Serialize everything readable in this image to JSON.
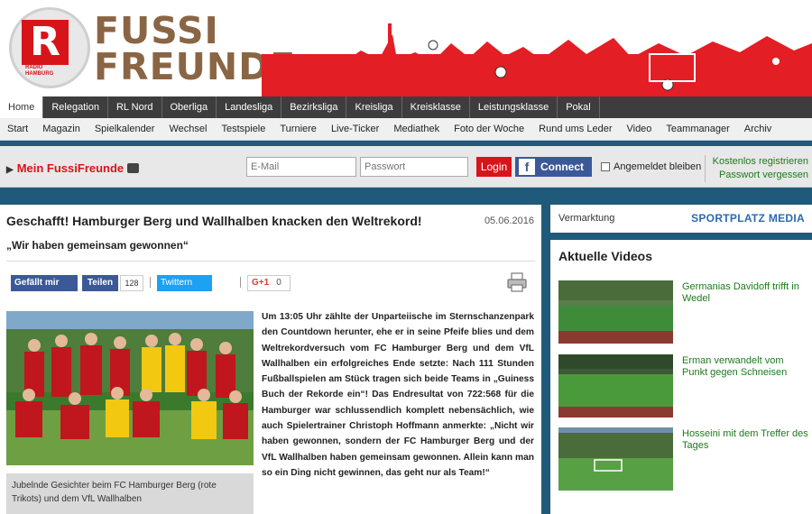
{
  "header": {
    "brand_line1": "FUSSI",
    "brand_line2": "FREUNDE",
    "logo_letter": "R",
    "logo_small": "RADIO HAMBURG",
    "accent": "#d8141b",
    "brand_color": "#8a6544"
  },
  "nav_primary": [
    {
      "label": "Home",
      "active": true
    },
    {
      "label": "Relegation"
    },
    {
      "label": "RL Nord"
    },
    {
      "label": "Oberliga"
    },
    {
      "label": "Landesliga"
    },
    {
      "label": "Bezirksliga"
    },
    {
      "label": "Kreisliga"
    },
    {
      "label": "Kreisklasse"
    },
    {
      "label": "Leistungsklasse"
    },
    {
      "label": "Pokal"
    }
  ],
  "nav_secondary": [
    {
      "label": "Start"
    },
    {
      "label": "Magazin"
    },
    {
      "label": "Spielkalender"
    },
    {
      "label": "Wechsel"
    },
    {
      "label": "Testspiele"
    },
    {
      "label": "Turniere"
    },
    {
      "label": "Live-Ticker"
    },
    {
      "label": "Mediathek"
    },
    {
      "label": "Foto der Woche"
    },
    {
      "label": "Rund ums Leder"
    },
    {
      "label": "Video"
    },
    {
      "label": "Teammanager"
    },
    {
      "label": "Archiv"
    }
  ],
  "login": {
    "mein_label": "Mein FussiFreunde",
    "email_placeholder": "E-Mail",
    "password_placeholder": "Passwort",
    "login_label": "Login",
    "connect_label": "Connect",
    "remember_label": "Angemeldet bleiben",
    "register_label": "Kostenlos registrieren",
    "forgot_label": "Passwort vergessen"
  },
  "article": {
    "headline": "Geschafft! Hamburger Berg und Wallhalben knacken den Weltrekord!",
    "date": "05.06.2016",
    "subheadline": "„Wir haben gemeinsam gewonnen“",
    "share": {
      "fb_like": "Gefällt mir",
      "fb_share": "Teilen",
      "fb_count": "128",
      "twitter": "Twittern",
      "gplus": "G+1",
      "gplus_count": "0"
    },
    "caption": "Jubelnde Gesichter beim FC Hamburger Berg (rote Trikots) und dem VfL Wallhalben",
    "body": "Um 13:05 Uhr zählte der Unparteiische im Sternschanzenpark den Countdown herunter, ehe er in seine Pfeife blies und dem Weltrekordversuch vom FC Hamburger Berg und dem VfL Wallhalben ein erfolgreiches Ende setzte: Nach 111 Stunden Fußballspielen am Stück tragen sich beide Teams in „Guiness Buch der Rekorde ein“! Das Endresultat von 722:568 für die Hamburger war schlussendlich komplett nebensächlich, wie auch Spielertrainer Christoph Hoffmann anmerkte: „Nicht wir haben gewonnen, sondern der FC Hamburger Berg und der VfL Wallhalben haben gemeinsam gewonnen. Allein kann man so ein Ding nicht gewinnen, das geht nur als Team!“"
  },
  "sidebar": {
    "marketing_label": "Vermarktung",
    "marketing_brand": "SPORTPLATZ MEDIA",
    "videos_title": "Aktuelle Videos",
    "videos": [
      {
        "label": "Germanias Davidoff trifft in Wedel"
      },
      {
        "label": "Erman verwandelt vom Punkt gegen Schneisen"
      },
      {
        "label": "Hosseini mit dem Treffer des Tages"
      }
    ]
  }
}
